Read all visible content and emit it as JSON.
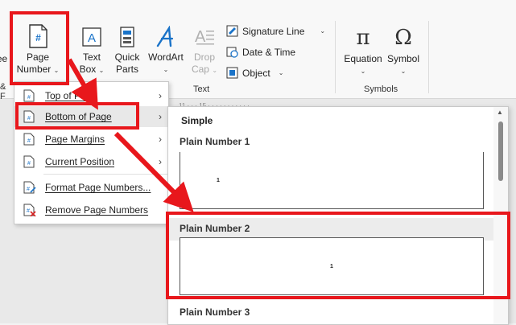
{
  "ribbon": {
    "left_clip_top": "ee",
    "left_clip_bottom": "& F",
    "page_number": {
      "line1": "Page",
      "line2": "Number"
    },
    "text_box": {
      "line1": "Text",
      "line2": "Box"
    },
    "quick_parts": {
      "line1": "Quick",
      "line2": "Parts"
    },
    "wordart": {
      "line1": "WordArt"
    },
    "drop_cap": {
      "line1": "Drop",
      "line2": "Cap"
    },
    "signature_line": "Signature Line",
    "date_time": "Date & Time",
    "object": "Object",
    "text_group": "Text",
    "equation": "Equation",
    "symbol": "Symbol",
    "symbols_group": "Symbols"
  },
  "menu": {
    "items": [
      {
        "label": "Top of Page",
        "icon": "page-number-icon",
        "has_submenu": true
      },
      {
        "label": "Bottom of Page",
        "icon": "page-number-icon",
        "has_submenu": true
      },
      {
        "label": "Page Margins",
        "icon": "page-number-icon",
        "has_submenu": true
      },
      {
        "label": "Current Position",
        "icon": "page-number-icon",
        "has_submenu": true
      },
      {
        "label": "Format Page Numbers...",
        "icon": "format-page-number-icon",
        "has_submenu": false
      },
      {
        "label": "Remove Page Numbers",
        "icon": "remove-page-number-icon",
        "has_submenu": false
      }
    ]
  },
  "gallery": {
    "section": "Simple",
    "items": [
      {
        "title": "Plain Number 1",
        "number": "1"
      },
      {
        "title": "Plain Number 2",
        "number": "1"
      },
      {
        "title": "Plain Number 3"
      }
    ]
  },
  "ruler": "11 · · · 15 · · · · · · · · · · ·",
  "colors": {
    "highlight": "#e8171c",
    "accent_blue": "#1a73c8"
  }
}
